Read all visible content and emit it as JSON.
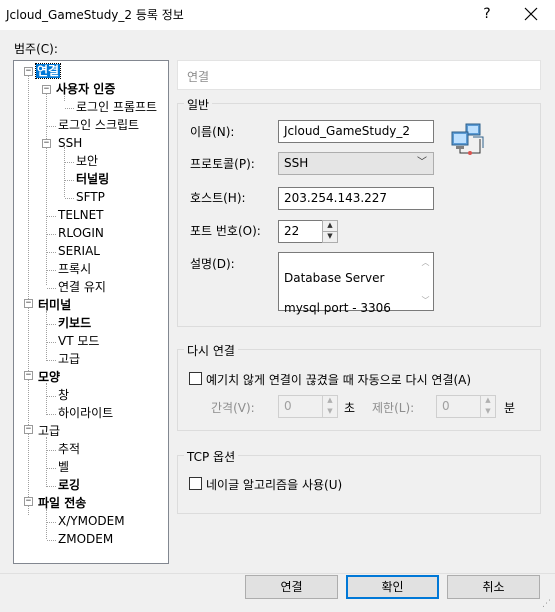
{
  "window": {
    "title": "Jcloud_GameStudy_2 등록 정보",
    "help": "?",
    "close": "✕"
  },
  "category_label": "범주(C):",
  "tree": [
    {
      "label": "연결",
      "selected": true
    },
    {
      "label": "사용자 인증"
    },
    {
      "label": "로그인 프롬프트"
    },
    {
      "label": "로그인 스크립트"
    },
    {
      "label": "SSH"
    },
    {
      "label": "보안"
    },
    {
      "label": "터널링"
    },
    {
      "label": "SFTP"
    },
    {
      "label": "TELNET"
    },
    {
      "label": "RLOGIN"
    },
    {
      "label": "SERIAL"
    },
    {
      "label": "프록시"
    },
    {
      "label": "연결 유지"
    },
    {
      "label": "터미널"
    },
    {
      "label": "키보드"
    },
    {
      "label": "VT 모드"
    },
    {
      "label": "고급"
    },
    {
      "label": "모양"
    },
    {
      "label": "창"
    },
    {
      "label": "하이라이트"
    },
    {
      "label": "고급"
    },
    {
      "label": "추적"
    },
    {
      "label": "벨"
    },
    {
      "label": "로깅"
    },
    {
      "label": "파일 전송"
    },
    {
      "label": "X/YMODEM"
    },
    {
      "label": "ZMODEM"
    }
  ],
  "section_title": "연결",
  "general": {
    "title": "일반",
    "name_label": "이름(N):",
    "name_value": "Jcloud_GameStudy_2",
    "protocol_label": "프로토콜(P):",
    "protocol_value": "SSH",
    "host_label": "호스트(H):",
    "host_value": "203.254.143.227",
    "port_label": "포트 번호(O):",
    "port_value": "22",
    "desc_label": "설명(D):",
    "desc_line1": "Database Server",
    "desc_line2": "mysql port - 3306"
  },
  "reconnect": {
    "title": "다시 연결",
    "auto_label": "예기치 않게 연결이 끊겼을 때 자동으로 다시 연결(A)",
    "auto_checked": false,
    "interval_label": "간격(V):",
    "interval_value": "0",
    "interval_unit": "초",
    "limit_label": "제한(L):",
    "limit_value": "0",
    "limit_unit": "분"
  },
  "tcp": {
    "title": "TCP 옵션",
    "nagle_label": "네이글 알고리즘을 사용(U)",
    "nagle_checked": false
  },
  "buttons": {
    "connect": "연결",
    "ok": "확인",
    "cancel": "취소"
  },
  "colors": {
    "selection": "#0078d7",
    "background": "#f0f0f0"
  }
}
